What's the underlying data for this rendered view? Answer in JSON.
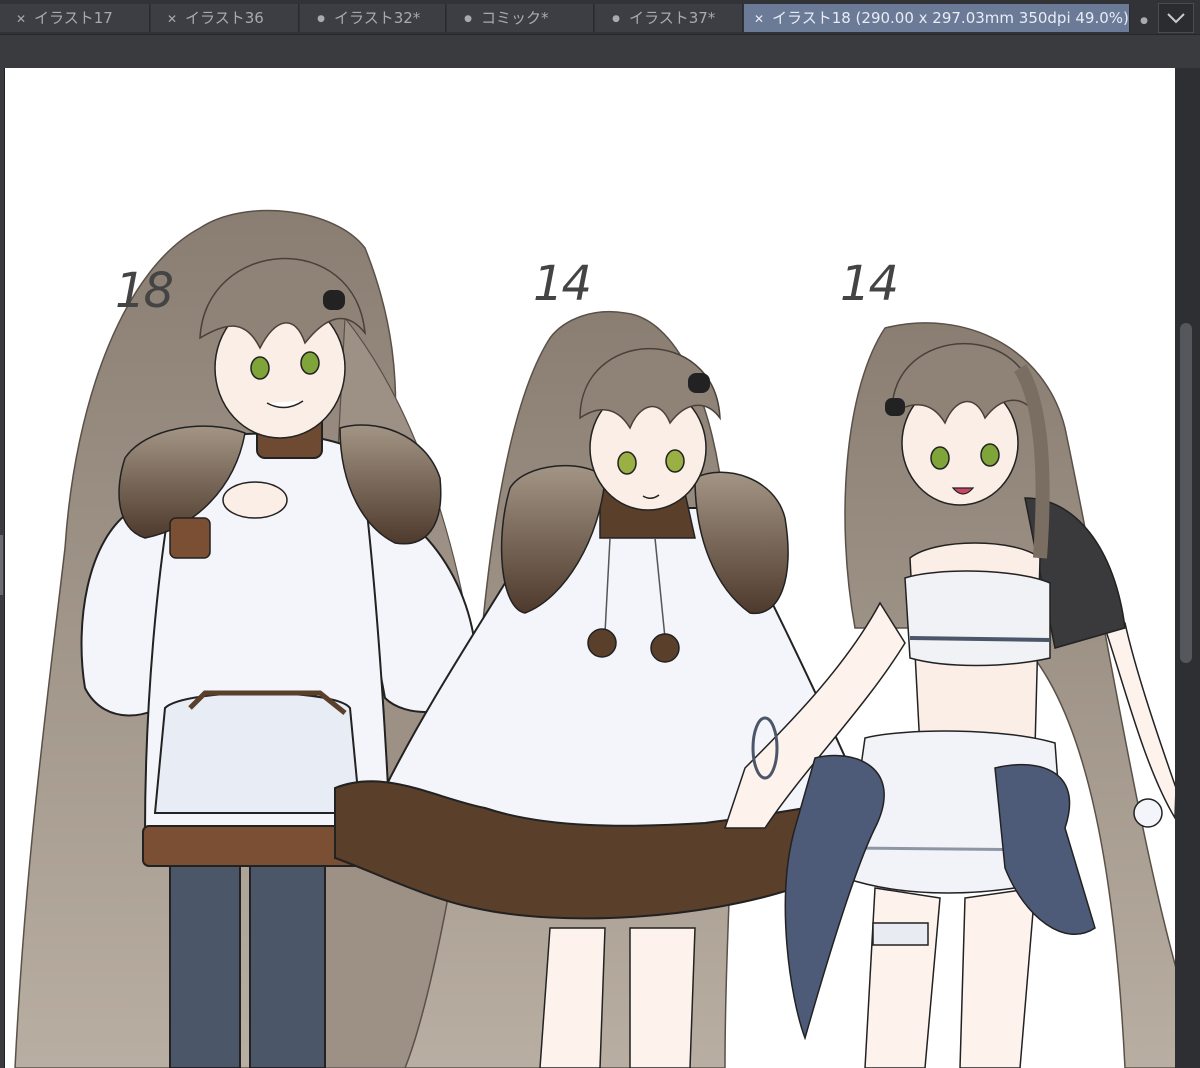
{
  "tabs": [
    {
      "label": "イラスト17",
      "icon": "close-icon"
    },
    {
      "label": "イラスト36",
      "icon": "close-icon"
    },
    {
      "label": "イラスト32*",
      "icon": "modified-dot-icon"
    },
    {
      "label": "コミック*",
      "icon": "modified-dot-icon"
    },
    {
      "label": "イラスト37*",
      "icon": "modified-dot-icon"
    },
    {
      "label": "イラスト18 (290.00 x 297.03mm 350dpi 49.0%)",
      "icon": "close-icon",
      "active": true
    }
  ],
  "canvas": {
    "age_labels": [
      "18",
      "14",
      "14"
    ]
  },
  "colors": {
    "tab_active": "#6b7a96",
    "tab_bg": "#3d3e43",
    "hair": "#9a8e82",
    "ears": "#5b4636",
    "fur": "#5a3f2a",
    "hoodie": "#f3f5fa",
    "legs": "#4b5668"
  }
}
